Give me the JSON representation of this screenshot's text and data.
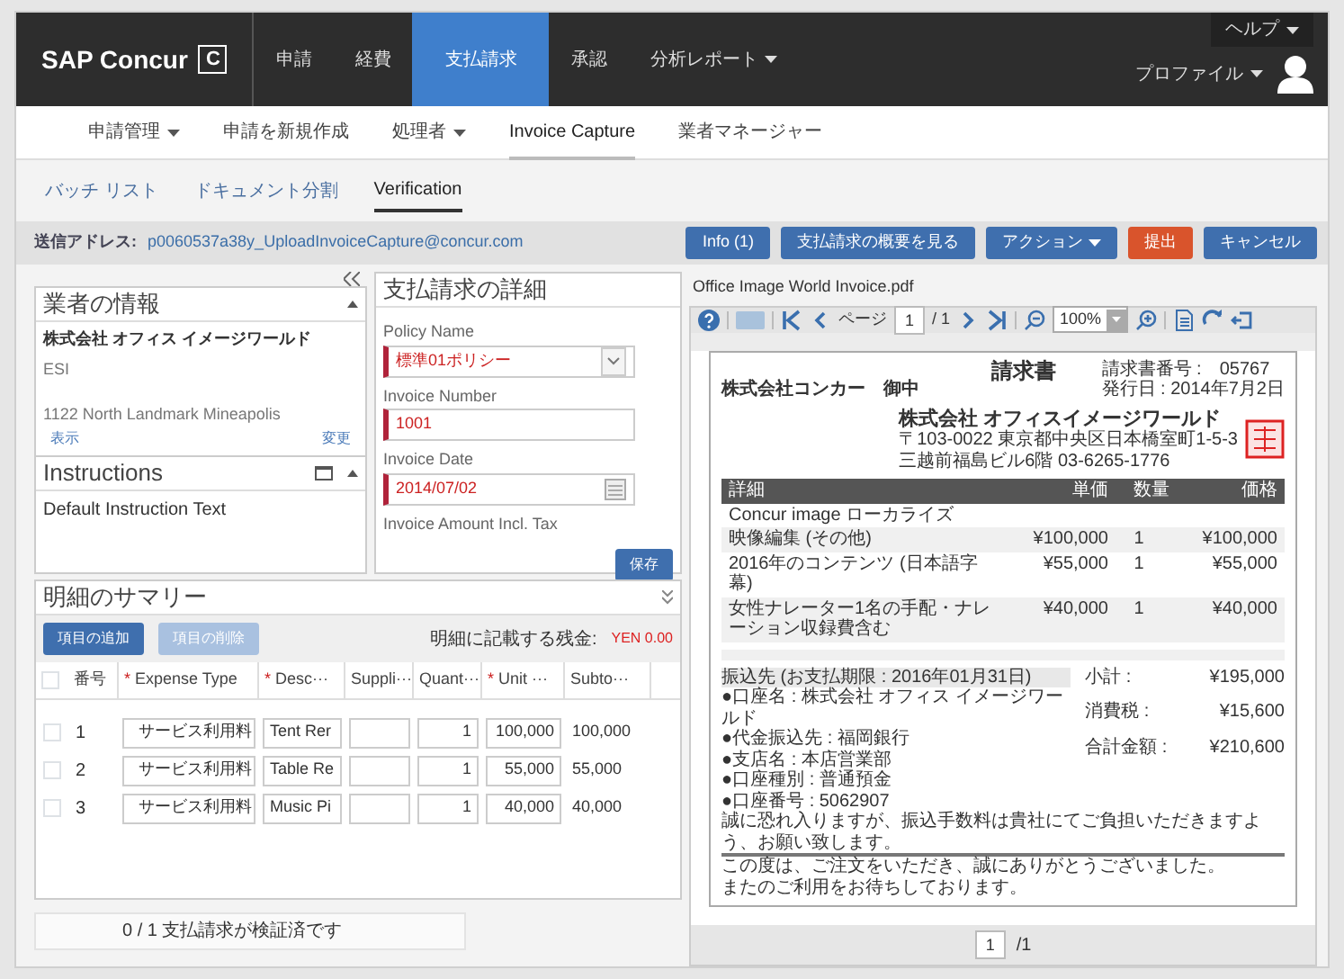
{
  "header": {
    "logo": "SAP Concur",
    "logo_mark": "C",
    "nav": [
      {
        "label": "申請",
        "selected": false,
        "dropdown": false
      },
      {
        "label": "経費",
        "selected": false,
        "dropdown": false
      },
      {
        "label": "支払請求",
        "selected": true,
        "dropdown": false
      },
      {
        "label": "承認",
        "selected": false,
        "dropdown": false
      },
      {
        "label": "分析レポート",
        "selected": false,
        "dropdown": true
      }
    ],
    "help": "ヘルプ",
    "profile": "プロファイル"
  },
  "subnav": [
    {
      "label": "申請管理",
      "selected": false,
      "dropdown": true
    },
    {
      "label": "申請を新規作成",
      "selected": false,
      "dropdown": false
    },
    {
      "label": "処理者",
      "selected": false,
      "dropdown": true
    },
    {
      "label": "Invoice Capture",
      "selected": true,
      "dropdown": false
    },
    {
      "label": "業者マネージャー",
      "selected": false,
      "dropdown": false
    }
  ],
  "tabs": [
    {
      "label": "バッチ リスト",
      "selected": false
    },
    {
      "label": "ドキュメント分割",
      "selected": false
    },
    {
      "label": "Verification",
      "selected": true
    }
  ],
  "toolbar": {
    "address_label": "送信アドレス:",
    "address": "p0060537a38y_UploadInvoiceCapture@concur.com",
    "buttons": [
      {
        "label": "Info (1)",
        "kind": "primary",
        "dropdown": false
      },
      {
        "label": "支払請求の概要を見る",
        "kind": "primary",
        "dropdown": false
      },
      {
        "label": "アクション",
        "kind": "primary",
        "dropdown": true
      },
      {
        "label": "提出",
        "kind": "danger",
        "dropdown": false
      },
      {
        "label": "キャンセル",
        "kind": "primary",
        "dropdown": false
      }
    ]
  },
  "vendor_panel": {
    "title": "業者の情報",
    "name": "株式会社 オフィス イメージワールド",
    "code": "ESI",
    "address": "1122 North Landmark Mineapolis",
    "links": [
      "表示",
      "変更"
    ]
  },
  "instructions_panel": {
    "title": "Instructions",
    "text": "Default Instruction Text"
  },
  "details_panel": {
    "title": "支払請求の詳細",
    "fields": [
      {
        "label": "Policy Name",
        "value": "標準01ポリシー",
        "kind": "select",
        "required": true
      },
      {
        "label": "Invoice Number",
        "value": "1001",
        "kind": "text",
        "required": true
      },
      {
        "label": "Invoice Date",
        "value": "2014/07/02",
        "kind": "date",
        "required": true
      },
      {
        "label": "Invoice Amount Incl. Tax",
        "kind": "label"
      }
    ],
    "save": "保存"
  },
  "summary": {
    "title": "明細のサマリー",
    "add_button": "項目の追加",
    "delete_button": "項目の削除",
    "delete_disabled": true,
    "remaining_label": "明細に記載する残金:",
    "remaining": "YEN 0.00",
    "all_checked": false,
    "columns": [
      {
        "label": "番号"
      },
      {
        "label": "Expense Type",
        "required_mark": "*"
      },
      {
        "label": "Desc···",
        "required_mark": "*"
      },
      {
        "label": "Suppli···"
      },
      {
        "label": "Quant···"
      },
      {
        "label": "Unit ···",
        "required_mark": "*"
      },
      {
        "label": "Subto···"
      }
    ],
    "rows": [
      {
        "checked": false,
        "number": "1",
        "expense_type": "サービス利用料",
        "description": "Tent Rer",
        "quantity": "1",
        "unit_price": "100,000",
        "subtotal": "100,000"
      },
      {
        "checked": false,
        "number": "2",
        "expense_type": "サービス利用料",
        "description": "Table Re",
        "quantity": "1",
        "unit_price": "55,000",
        "subtotal": "55,000"
      },
      {
        "checked": false,
        "number": "3",
        "expense_type": "サービス利用料",
        "description": "Music Pi",
        "quantity": "1",
        "unit_price": "40,000",
        "subtotal": "40,000"
      }
    ]
  },
  "status": "0 / 1 支払請求が検証済です",
  "viewer": {
    "filename": "Office Image World Invoice.pdf",
    "page_label": "ページ",
    "page": "1",
    "page_total": "/ 1",
    "zoom": "100%",
    "footer_page": "1",
    "footer_total": "/1",
    "document": {
      "title": "請求書",
      "recipient": "株式会社コンカー　御中",
      "meta": [
        "請求書番号 :　05767",
        "発行日 : 2014年7月2日"
      ],
      "issuer": "株式会社 オフィスイメージワールド",
      "issuer_lines": [
        "〒103-0022 東京都中央区日本橋室町1-5-3",
        "三越前福島ビル6階 03-6265-1776"
      ],
      "columns": [
        "詳細",
        "単価",
        "数量",
        "価格"
      ],
      "section": "Concur image ローカライズ",
      "lines": [
        {
          "item": "映像編集 (その他)",
          "price": "¥100,000",
          "qty": "1",
          "amount": "¥100,000"
        },
        {
          "item": "2016年のコンテンツ (日本語字幕)",
          "price": "¥55,000",
          "qty": "1",
          "amount": "¥55,000"
        },
        {
          "item": "女性ナレーター1名の手配・ナレーション収録費含む",
          "price": "¥40,000",
          "qty": "1",
          "amount": "¥40,000"
        }
      ],
      "bank_title": "振込先 (お支払期限 : 2016年01月31日)",
      "bank_lines": [
        "●口座名 : 株式会社 オフィス イメージワールド",
        "●代金振込先 : 福岡銀行",
        "●支店名 : 本店営業部",
        "●口座種別 : 普通預金",
        "●口座番号 : 5062907"
      ],
      "bank_note": "誠に恐れ入りますが、振込手数料は貴社にてご負担いただきますよう、お願い致します。",
      "totals": [
        {
          "label": "小計 :",
          "value": "¥195,000"
        },
        {
          "label": "消費税 :",
          "value": "¥15,600"
        },
        {
          "label": "合計金額 :",
          "value": "¥210,600"
        }
      ],
      "note": [
        "この度は、ご注文をいただき、誠にありがとうございました。",
        "またのご利用をお待ちしております。"
      ]
    }
  }
}
